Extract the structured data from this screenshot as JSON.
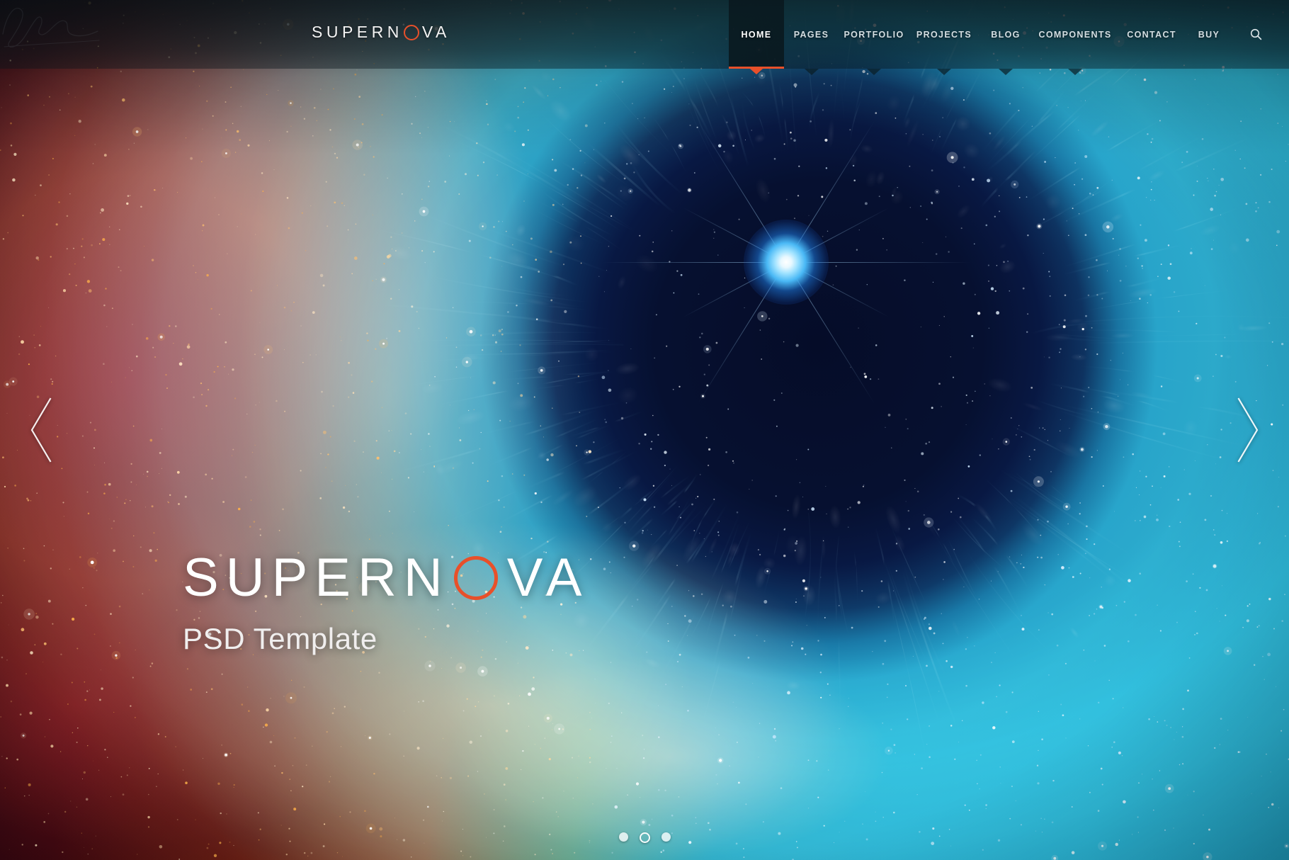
{
  "site": {
    "logo_text_before": "SUPERN",
    "logo_icon": "red-ring-o",
    "logo_text_after": "VA",
    "logo_full": "SUPERNOVA"
  },
  "header": {
    "nav": [
      {
        "label": "HOME",
        "active": true,
        "has_dropdown": true
      },
      {
        "label": "PAGES",
        "active": false,
        "has_dropdown": true
      },
      {
        "label": "PORTFOLIO",
        "active": false,
        "has_dropdown": true
      },
      {
        "label": "PROJECTS",
        "active": false,
        "has_dropdown": true
      },
      {
        "label": "BLOG",
        "active": false,
        "has_dropdown": true
      },
      {
        "label": "COMPONENTS",
        "active": false,
        "has_dropdown": true
      },
      {
        "label": "CONTACT",
        "active": false,
        "has_dropdown": false
      },
      {
        "label": "BUY",
        "active": false,
        "has_dropdown": false
      }
    ],
    "search_icon": "search-icon",
    "search_label": "Search"
  },
  "hero": {
    "title_before": "SUPERN",
    "title_icon": "red-ring-o",
    "title_after": "VA",
    "title_full": "SUPERNOVA",
    "subtitle": "PSD Template"
  },
  "slider": {
    "prev_icon": "chevron-left-icon",
    "next_icon": "chevron-right-icon",
    "prev_label": "Previous slide",
    "next_label": "Next slide",
    "dots": [
      {
        "active": false
      },
      {
        "active": true
      },
      {
        "active": false
      }
    ],
    "active_index": 1,
    "total": 3
  },
  "colors": {
    "accent": "#e8502a",
    "nav_text": "#d4dee2",
    "nav_text_active": "#ffffff",
    "hero_text": "#ffffff",
    "header_bg": "rgba(8,20,26,0.62)",
    "nebula_warm": "#c6521a",
    "nebula_cool": "#2cbde4",
    "nebula_core": "#071233"
  }
}
